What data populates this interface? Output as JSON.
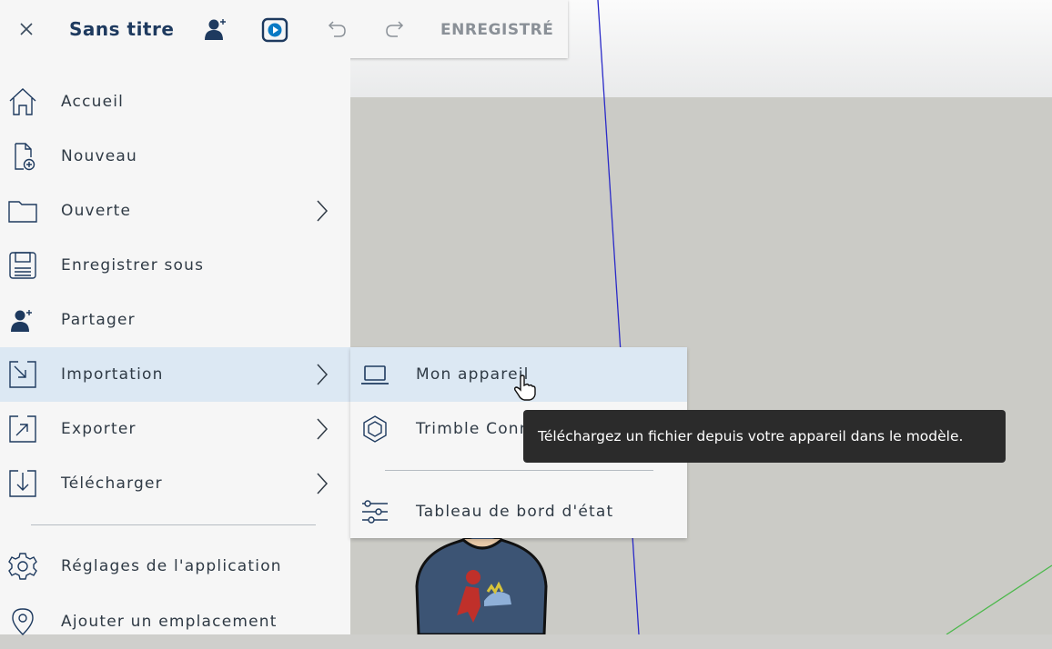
{
  "header": {
    "title": "Sans titre",
    "status": "ENREGISTRÉ"
  },
  "menu": {
    "items": [
      {
        "label": "Accueil"
      },
      {
        "label": "Nouveau"
      },
      {
        "label": "Ouverte"
      },
      {
        "label": "Enregistrer sous"
      },
      {
        "label": "Partager"
      },
      {
        "label": "Importation"
      },
      {
        "label": "Exporter"
      },
      {
        "label": "Télécharger"
      },
      {
        "label": "Réglages de l'application"
      },
      {
        "label": "Ajouter un emplacement"
      }
    ]
  },
  "submenu": {
    "items": [
      {
        "label": "Mon appareil"
      },
      {
        "label": "Trimble Connect"
      },
      {
        "label": "Tableau de bord d'état"
      }
    ]
  },
  "tooltip": {
    "text": "Téléchargez un fichier depuis votre appareil dans le modèle."
  },
  "colors": {
    "menu_bg": "#f6f6f6",
    "active_bg": "#dce8f3",
    "icon": "#1e3a5f",
    "accent": "#0a7ac4"
  }
}
